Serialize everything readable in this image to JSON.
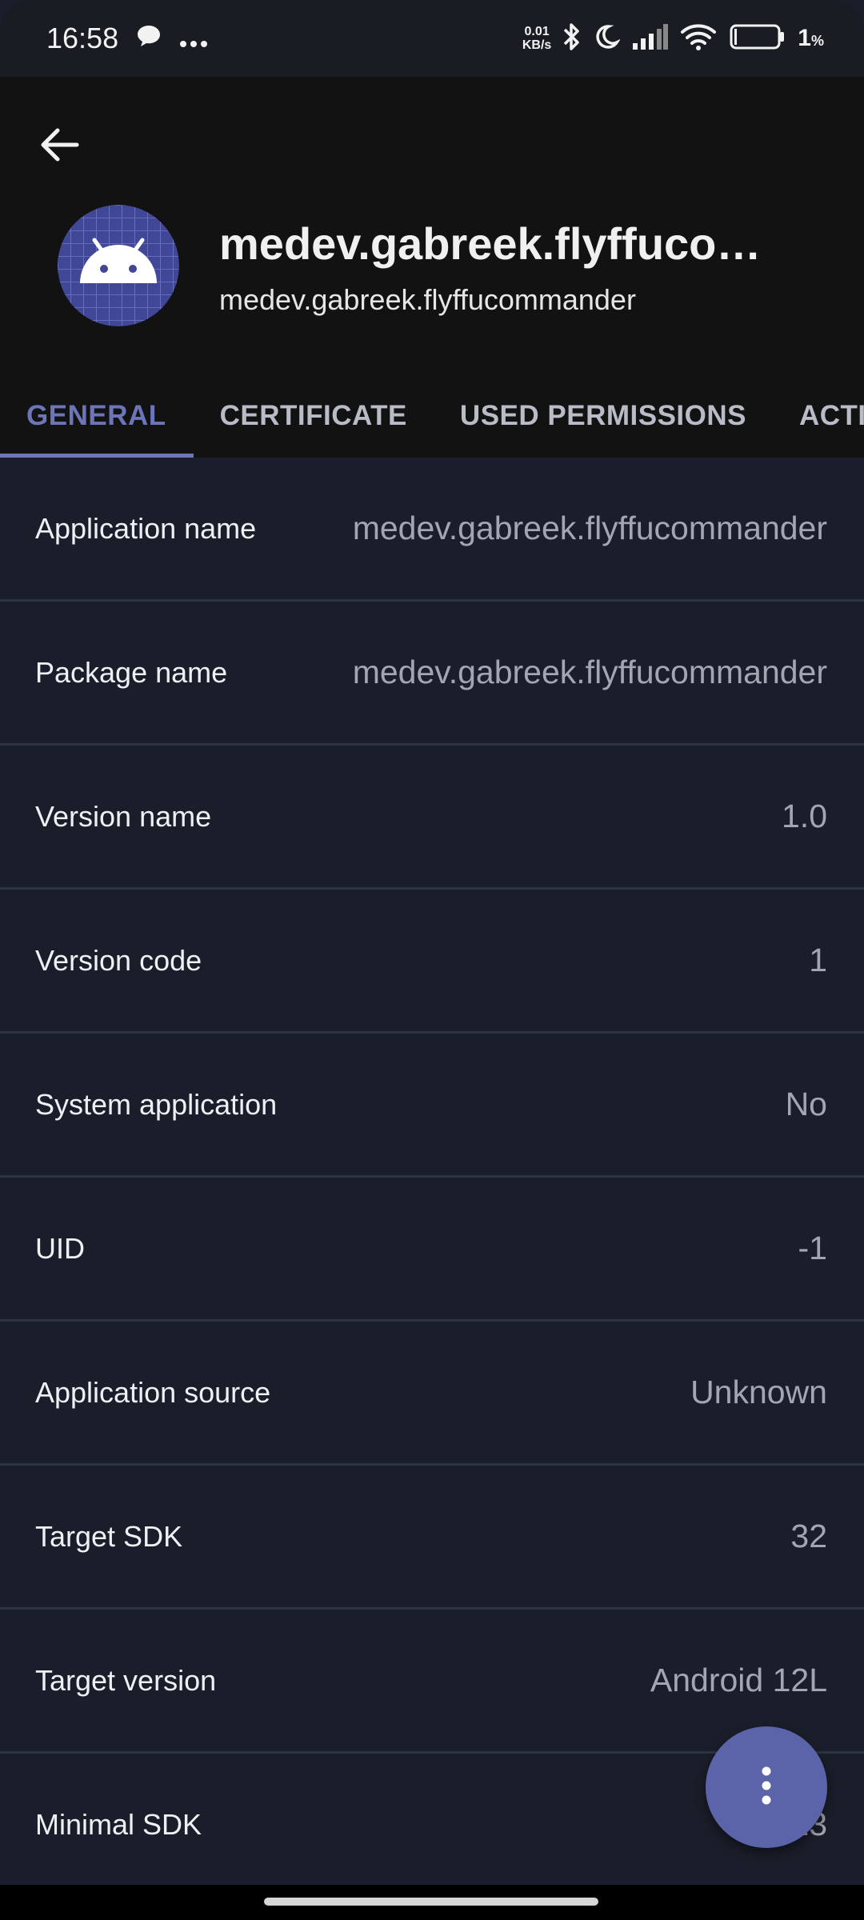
{
  "status_bar": {
    "time": "16:58",
    "net_speed_value": "0.01",
    "net_speed_unit": "KB/s",
    "battery_pct": "1",
    "battery_unit": "%",
    "icons": [
      "message-icon",
      "more-icon",
      "bluetooth-icon",
      "moon-icon",
      "signal-icon",
      "wifi-icon",
      "battery-icon"
    ]
  },
  "app": {
    "title": "medev.gabreek.flyffucommander",
    "package": "medev.gabreek.flyffucommander",
    "back_icon": "arrow-back-icon",
    "icon": "android-app-icon"
  },
  "tabs": [
    {
      "label": "GENERAL",
      "active": true
    },
    {
      "label": "CERTIFICATE",
      "active": false
    },
    {
      "label": "USED PERMISSIONS",
      "active": false
    },
    {
      "label": "ACTIVITIES",
      "active": false
    }
  ],
  "details": [
    {
      "label": "Application name",
      "value": "medev.gabreek.flyffucommander"
    },
    {
      "label": "Package name",
      "value": "medev.gabreek.flyffucommander"
    },
    {
      "label": "Version name",
      "value": "1.0"
    },
    {
      "label": "Version code",
      "value": "1"
    },
    {
      "label": "System application",
      "value": "No"
    },
    {
      "label": "UID",
      "value": "-1"
    },
    {
      "label": "Application source",
      "value": "Unknown"
    },
    {
      "label": "Target SDK",
      "value": "32"
    },
    {
      "label": "Target version",
      "value": "Android 12L"
    },
    {
      "label": "Minimal SDK",
      "value": "23"
    }
  ],
  "fab": {
    "icon": "more-vertical-icon"
  },
  "colors": {
    "accent": "#6c75b8",
    "fab": "#5b64a8",
    "background": "#1a1e2a",
    "header": "#121212"
  }
}
